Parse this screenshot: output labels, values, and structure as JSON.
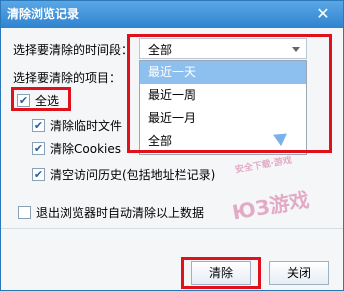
{
  "dialog": {
    "title": "清除浏览记录",
    "close_glyph": "✕"
  },
  "time_range": {
    "label": "选择要清除的时间段：",
    "selected": "全部",
    "options": [
      "最近一天",
      "最近一周",
      "最近一月",
      "全部"
    ],
    "highlighted_index": 0
  },
  "items": {
    "label": "选择要清除的项目：",
    "select_all": {
      "label": "全选",
      "checked": true
    },
    "entries": [
      {
        "label": "清除临时文件",
        "checked": true
      },
      {
        "label": "清除Cookies",
        "checked": true
      },
      {
        "label": "清空访问历史(包括地址栏记录)",
        "checked": true
      }
    ]
  },
  "auto_clear": {
    "label": "退出浏览器时自动清除以上数据",
    "checked": false
  },
  "buttons": {
    "clear": "清除",
    "close": "关闭"
  },
  "watermark": {
    "text": "ЮЗ游戏",
    "sub": "安全下载·游戏"
  },
  "icons": {
    "check": "check-icon",
    "dropdown_arrow": "chevron-down-icon",
    "close": "close-icon",
    "cursor": "mouse-cursor-icon"
  },
  "colors": {
    "title_bar": "#2f83cf",
    "highlight": "#8ec0ef",
    "annotation": "#e0111a"
  }
}
